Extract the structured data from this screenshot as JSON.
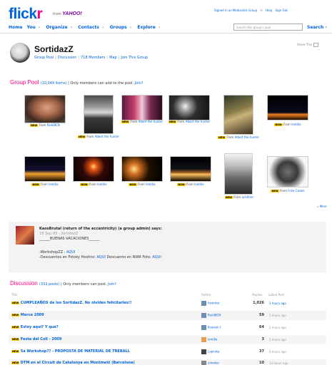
{
  "header": {
    "logo_part1": "flick",
    "logo_part2": "r",
    "from": "from",
    "yahoo": "YAHOO!",
    "top_links": [
      "Signed in as Mediaclick Group",
      "Help",
      "Sign Out"
    ],
    "nav": [
      "Home",
      "You",
      "Organize",
      "Contacts",
      "Groups",
      "Explore"
    ],
    "search_placeholder": "Search this group's pool",
    "search_label": "Search"
  },
  "group": {
    "name": "SortidazZ",
    "links": [
      "Group Pool",
      "Discussion",
      "718 Members",
      "Map",
      "Join This Group"
    ],
    "share_label": "Share This"
  },
  "pool": {
    "heading": "Group Pool",
    "count_link": "(10,049 items)",
    "note": "Only members can add to the pool.",
    "join_label": "Join?",
    "new_badge": "NEW",
    "from": "From",
    "photos": [
      {
        "owner": "ReldiBCN"
      },
      {
        "owner": "Albert the hunter"
      },
      {
        "owner": "Albert the hunter"
      },
      {
        "owner": "Albert the hunter"
      },
      {
        "owner": "Albert the hunter"
      },
      {
        "owner": "lentilla"
      },
      {
        "owner": "lentilla"
      },
      {
        "owner": "lentilla"
      },
      {
        "owner": "lentilla"
      },
      {
        "owner": "lentilla"
      },
      {
        "owner": "acidtrier"
      },
      {
        "owner": "Felix Casals"
      }
    ],
    "more": "» More"
  },
  "admin_comment": {
    "header": "KaosBrutal (return of the eccentricity) (a group admin) says:",
    "date": "18 Sep 09",
    "group": "SortidazZ",
    "line1": "______BUENAS VACACIONES______",
    "workshop_label": "-WorkshopZZ :",
    "workshop_link": "AQUI",
    "discount_label": "-Descuentos en Fotoky Hostinz:",
    "discount_link1": "AQUI",
    "discount_label2": "Descuento en NWR Foto:",
    "discount_link2": "AQUI"
  },
  "discussion": {
    "heading": "Discussion",
    "count_link": "(332 posts)",
    "note": "Only members can post.",
    "join_label": "Join?",
    "columns": {
      "title": "Title",
      "author": "Author",
      "replies": "Replies",
      "latest": "Latest Post"
    },
    "threads": [
      {
        "title": "CUMPLEAÑOS de los SortidazZ. No olvides felicitarles!!",
        "author": "hookitar",
        "replies": "1,026",
        "latest": "2 hours ago"
      },
      {
        "title": "Merce 2009",
        "author": "ReldiBCN",
        "replies": "59",
        "latest": "2 hours ago"
      },
      {
        "title": "Estoy aquí? Y qué?",
        "author": "Itsaslan.t",
        "replies": "64",
        "latest": "2 hours ago"
      },
      {
        "title": "Festa del Coll - 2009",
        "author": "lentilla",
        "replies": "3",
        "latest": "2 hours ago"
      },
      {
        "title": "5a Workshop?? - PROPOSTA DE MATERIAL DE TREBALL",
        "author": "Lapirata",
        "replies": "37",
        "latest": "6 hours ago"
      },
      {
        "title": "DTM en el Circuit de Catalunya en Montmeló (Barcelona)",
        "author": "elmoker",
        "replies": "10",
        "latest": "14 hours ago"
      }
    ]
  }
}
